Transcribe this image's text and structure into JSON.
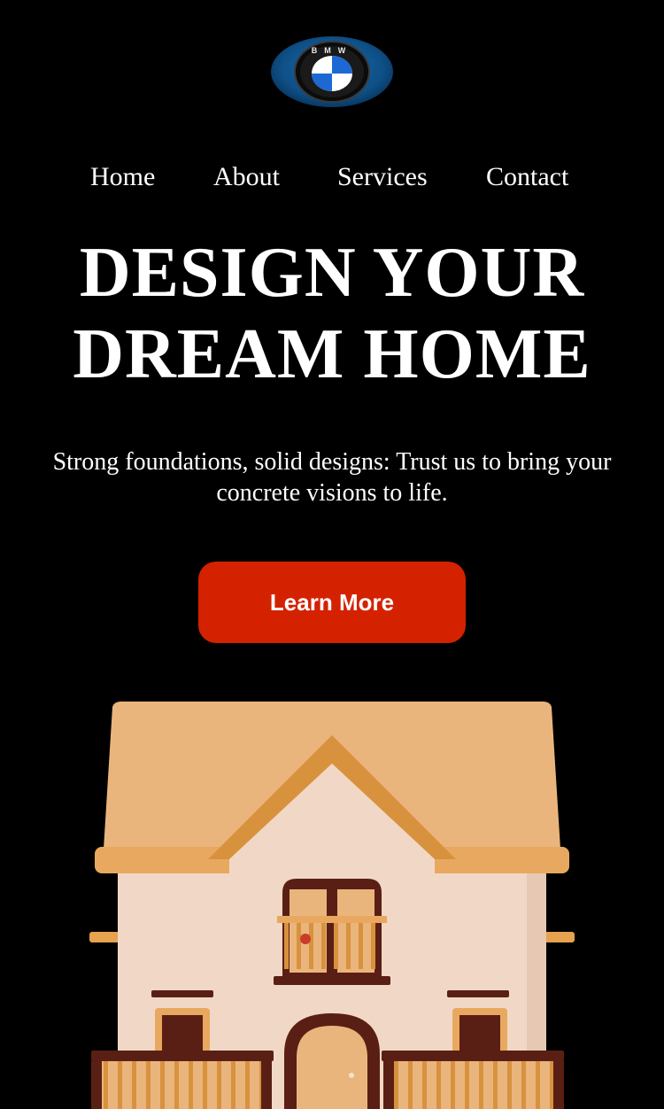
{
  "logo": {
    "icon": "bmw-roundel-icon",
    "letters": "BMW"
  },
  "nav": {
    "items": [
      {
        "label": "Home"
      },
      {
        "label": "About"
      },
      {
        "label": "Services"
      },
      {
        "label": "Contact"
      }
    ]
  },
  "hero": {
    "title": "DESIGN YOUR DREAM HOME",
    "subtitle": "Strong foundations, solid designs: Trust us to bring your concrete visions to life.",
    "cta_label": "Learn More"
  },
  "image": {
    "icon": "house-illustration-icon"
  },
  "colors": {
    "background": "#000000",
    "text": "#ffffff",
    "cta": "#d42200",
    "roof": "#eab57c",
    "wall": "#f1d8c6",
    "trim": "#5a1f14"
  }
}
